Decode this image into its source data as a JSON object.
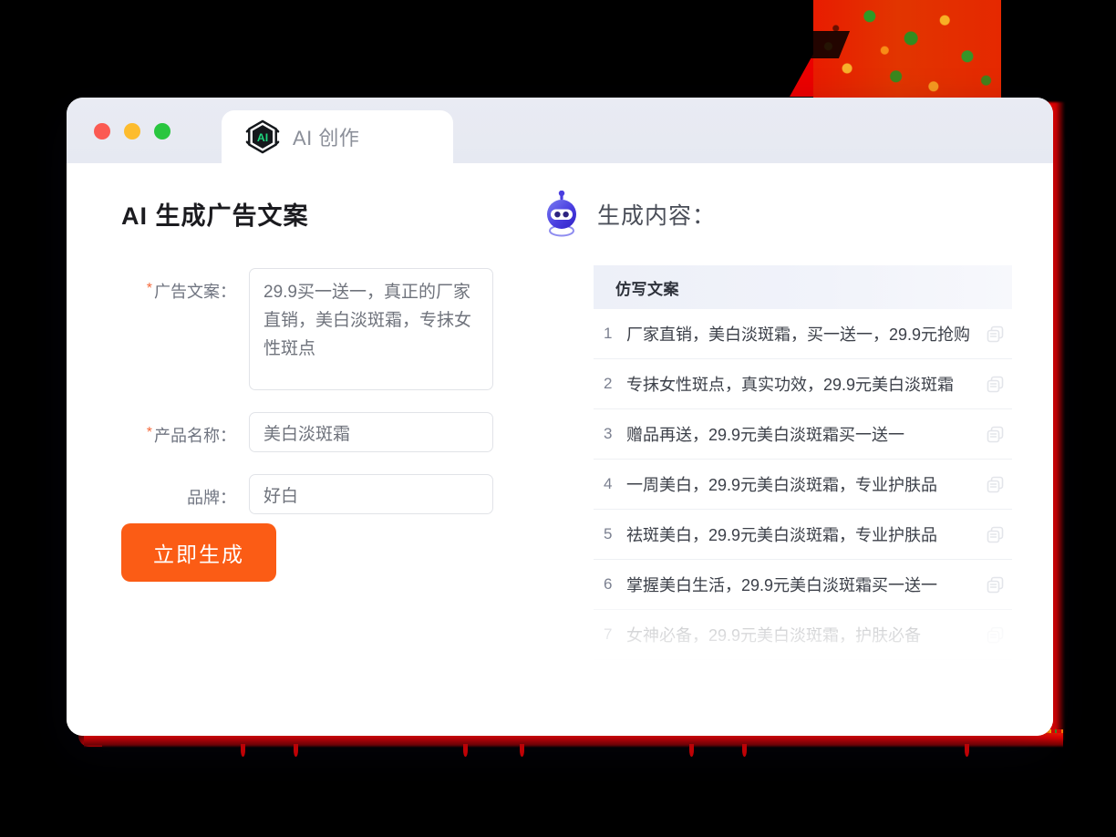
{
  "window": {
    "traffic_lights": [
      {
        "name": "close",
        "color": "#fb5a52"
      },
      {
        "name": "minimize",
        "color": "#fdbc2e"
      },
      {
        "name": "maximize",
        "color": "#29c63f"
      }
    ],
    "tab": {
      "icon": "ai-hexagon-icon",
      "label": "AI 创作"
    }
  },
  "left": {
    "page_title": "AI 生成广告文案",
    "fields": [
      {
        "key": "ad_copy",
        "label": "广告文案：",
        "required": true,
        "type": "textarea",
        "value": "29.9买一送一，真正的厂家直销，美白淡斑霜，专抹女性斑点",
        "placeholder": "请输入广告文案"
      },
      {
        "key": "product_name",
        "label": "产品名称：",
        "required": true,
        "type": "input",
        "value": "美白淡斑霜",
        "placeholder": "请输入产品名称"
      },
      {
        "key": "brand",
        "label": "品牌：",
        "required": false,
        "type": "input",
        "value": "好白",
        "placeholder": "请输入品牌"
      }
    ],
    "generate_button": "立即生成",
    "accent_color": "#fb5c15",
    "required_star_color": "#f56a3c"
  },
  "right": {
    "icon": "robot-icon",
    "title": "生成内容：",
    "table": {
      "header": "仿写文案",
      "copy_icon": "copy-icon",
      "rows": [
        {
          "index": "1",
          "text": "厂家直销，美白淡斑霜，买一送一，29.9元抢购"
        },
        {
          "index": "2",
          "text": "专抹女性斑点，真实功效，29.9元美白淡斑霜"
        },
        {
          "index": "3",
          "text": "赠品再送，29.9元美白淡斑霜买一送一"
        },
        {
          "index": "4",
          "text": "一周美白，29.9元美白淡斑霜，专业护肤品"
        },
        {
          "index": "5",
          "text": "祛斑美白，29.9元美白淡斑霜，专业护肤品"
        },
        {
          "index": "6",
          "text": "掌握美白生活，29.9元美白淡斑霜买一送一"
        },
        {
          "index": "7",
          "text": "女神必备，29.9元美白淡斑霜，护肤必备"
        }
      ]
    }
  },
  "decor": {
    "background_color": "#000000",
    "glow_color": "#e00000",
    "wedge_color": "#e52800"
  }
}
